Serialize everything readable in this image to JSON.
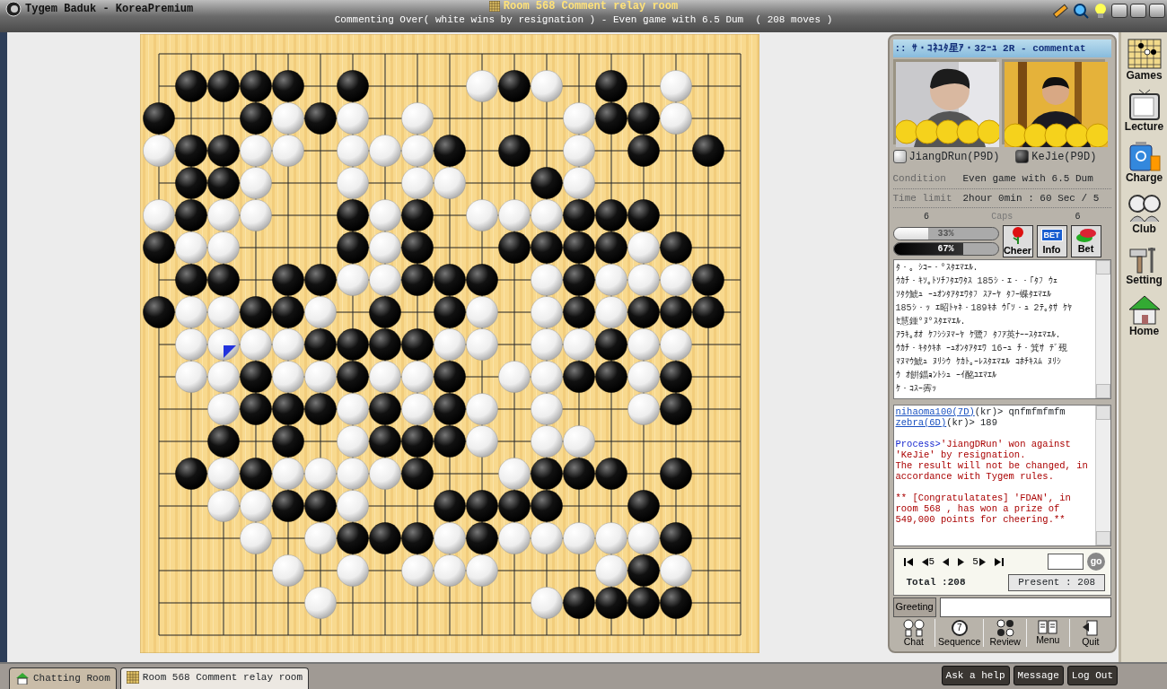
{
  "title_bar": {
    "app_title": "Tygem Baduk - KoreaPremium",
    "room_title": "Room 568 Comment relay room",
    "status": "Commenting Over( white wins by resignation ) - Even game with 6.5 Dum  ( 208 moves )"
  },
  "board": {
    "rows": [
      {
        "cells": [
          {
            "kind": "empty"
          },
          {
            "kind": "empty"
          },
          {
            "kind": "empty"
          },
          {
            "kind": "empty"
          },
          {
            "kind": "empty"
          },
          {
            "kind": "empty"
          },
          {
            "kind": "empty"
          },
          {
            "kind": "empty"
          },
          {
            "kind": "empty"
          },
          {
            "kind": "empty"
          },
          {
            "kind": "empty"
          },
          {
            "kind": "empty"
          },
          {
            "kind": "empty"
          },
          {
            "kind": "empty"
          },
          {
            "kind": "empty"
          },
          {
            "kind": "empty"
          },
          {
            "kind": "empty"
          },
          {
            "kind": "empty"
          },
          {
            "kind": "empty"
          }
        ]
      },
      {
        "cells": [
          {
            "kind": "empty"
          },
          {
            "kind": "black"
          },
          {
            "kind": "black"
          },
          {
            "kind": "black"
          },
          {
            "kind": "black"
          },
          {
            "kind": "empty"
          },
          {
            "kind": "black"
          },
          {
            "kind": "empty"
          },
          {
            "kind": "empty"
          },
          {
            "kind": "empty"
          },
          {
            "kind": "white"
          },
          {
            "kind": "black"
          },
          {
            "kind": "white"
          },
          {
            "kind": "empty"
          },
          {
            "kind": "black"
          },
          {
            "kind": "empty"
          },
          {
            "kind": "white"
          },
          {
            "kind": "empty"
          },
          {
            "kind": "empty"
          }
        ]
      },
      {
        "cells": [
          {
            "kind": "black"
          },
          {
            "kind": "empty"
          },
          {
            "kind": "empty"
          },
          {
            "kind": "black"
          },
          {
            "kind": "white"
          },
          {
            "kind": "black"
          },
          {
            "kind": "white"
          },
          {
            "kind": "empty"
          },
          {
            "kind": "white"
          },
          {
            "kind": "empty"
          },
          {
            "kind": "empty"
          },
          {
            "kind": "empty"
          },
          {
            "kind": "empty"
          },
          {
            "kind": "white"
          },
          {
            "kind": "black"
          },
          {
            "kind": "black"
          },
          {
            "kind": "white"
          },
          {
            "kind": "empty"
          },
          {
            "kind": "empty"
          }
        ]
      },
      {
        "cells": [
          {
            "kind": "white"
          },
          {
            "kind": "black"
          },
          {
            "kind": "black"
          },
          {
            "kind": "white"
          },
          {
            "kind": "white"
          },
          {
            "kind": "empty"
          },
          {
            "kind": "white"
          },
          {
            "kind": "white"
          },
          {
            "kind": "white"
          },
          {
            "kind": "black"
          },
          {
            "kind": "empty"
          },
          {
            "kind": "black"
          },
          {
            "kind": "empty"
          },
          {
            "kind": "white"
          },
          {
            "kind": "empty"
          },
          {
            "kind": "black"
          },
          {
            "kind": "empty"
          },
          {
            "kind": "black"
          },
          {
            "kind": "empty"
          }
        ]
      },
      {
        "cells": [
          {
            "kind": "empty"
          },
          {
            "kind": "black"
          },
          {
            "kind": "black"
          },
          {
            "kind": "white"
          },
          {
            "kind": "empty"
          },
          {
            "kind": "empty"
          },
          {
            "kind": "white"
          },
          {
            "kind": "empty"
          },
          {
            "kind": "white"
          },
          {
            "kind": "white"
          },
          {
            "kind": "empty"
          },
          {
            "kind": "empty"
          },
          {
            "kind": "black"
          },
          {
            "kind": "white"
          },
          {
            "kind": "empty"
          },
          {
            "kind": "empty"
          },
          {
            "kind": "empty"
          },
          {
            "kind": "empty"
          },
          {
            "kind": "empty"
          }
        ]
      },
      {
        "cells": [
          {
            "kind": "white"
          },
          {
            "kind": "black"
          },
          {
            "kind": "white"
          },
          {
            "kind": "white"
          },
          {
            "kind": "empty"
          },
          {
            "kind": "empty"
          },
          {
            "kind": "black"
          },
          {
            "kind": "white"
          },
          {
            "kind": "black"
          },
          {
            "kind": "empty"
          },
          {
            "kind": "white"
          },
          {
            "kind": "white"
          },
          {
            "kind": "white"
          },
          {
            "kind": "black"
          },
          {
            "kind": "black"
          },
          {
            "kind": "black"
          },
          {
            "kind": "empty"
          },
          {
            "kind": "empty"
          },
          {
            "kind": "empty"
          }
        ]
      },
      {
        "cells": [
          {
            "kind": "black"
          },
          {
            "kind": "white"
          },
          {
            "kind": "white"
          },
          {
            "kind": "empty"
          },
          {
            "kind": "empty"
          },
          {
            "kind": "empty"
          },
          {
            "kind": "black"
          },
          {
            "kind": "white"
          },
          {
            "kind": "black"
          },
          {
            "kind": "empty"
          },
          {
            "kind": "empty"
          },
          {
            "kind": "black"
          },
          {
            "kind": "black"
          },
          {
            "kind": "black"
          },
          {
            "kind": "black"
          },
          {
            "kind": "white"
          },
          {
            "kind": "black"
          },
          {
            "kind": "empty"
          },
          {
            "kind": "empty"
          }
        ]
      },
      {
        "cells": [
          {
            "kind": "empty"
          },
          {
            "kind": "black"
          },
          {
            "kind": "black"
          },
          {
            "kind": "empty"
          },
          {
            "kind": "black"
          },
          {
            "kind": "black"
          },
          {
            "kind": "white"
          },
          {
            "kind": "white"
          },
          {
            "kind": "black"
          },
          {
            "kind": "black"
          },
          {
            "kind": "black"
          },
          {
            "kind": "empty"
          },
          {
            "kind": "white"
          },
          {
            "kind": "black"
          },
          {
            "kind": "white"
          },
          {
            "kind": "white"
          },
          {
            "kind": "white"
          },
          {
            "kind": "black"
          },
          {
            "kind": "empty"
          }
        ]
      },
      {
        "cells": [
          {
            "kind": "black"
          },
          {
            "kind": "white"
          },
          {
            "kind": "white"
          },
          {
            "kind": "black"
          },
          {
            "kind": "black"
          },
          {
            "kind": "white"
          },
          {
            "kind": "empty"
          },
          {
            "kind": "black"
          },
          {
            "kind": "empty"
          },
          {
            "kind": "black"
          },
          {
            "kind": "white"
          },
          {
            "kind": "empty"
          },
          {
            "kind": "white"
          },
          {
            "kind": "black"
          },
          {
            "kind": "white"
          },
          {
            "kind": "black"
          },
          {
            "kind": "black"
          },
          {
            "kind": "black"
          },
          {
            "kind": "empty"
          }
        ]
      },
      {
        "cells": [
          {
            "kind": "empty"
          },
          {
            "kind": "white"
          },
          {
            "kind": "white",
            "last_move": true
          },
          {
            "kind": "white"
          },
          {
            "kind": "white"
          },
          {
            "kind": "black"
          },
          {
            "kind": "black"
          },
          {
            "kind": "black"
          },
          {
            "kind": "black"
          },
          {
            "kind": "white"
          },
          {
            "kind": "white"
          },
          {
            "kind": "empty"
          },
          {
            "kind": "white"
          },
          {
            "kind": "white"
          },
          {
            "kind": "black"
          },
          {
            "kind": "white"
          },
          {
            "kind": "white"
          },
          {
            "kind": "empty"
          },
          {
            "kind": "empty"
          }
        ]
      },
      {
        "cells": [
          {
            "kind": "empty"
          },
          {
            "kind": "white"
          },
          {
            "kind": "white"
          },
          {
            "kind": "black"
          },
          {
            "kind": "white"
          },
          {
            "kind": "white"
          },
          {
            "kind": "black"
          },
          {
            "kind": "white"
          },
          {
            "kind": "white"
          },
          {
            "kind": "black"
          },
          {
            "kind": "empty"
          },
          {
            "kind": "white"
          },
          {
            "kind": "white"
          },
          {
            "kind": "black"
          },
          {
            "kind": "black"
          },
          {
            "kind": "white"
          },
          {
            "kind": "black"
          },
          {
            "kind": "empty"
          },
          {
            "kind": "empty"
          }
        ]
      },
      {
        "cells": [
          {
            "kind": "empty"
          },
          {
            "kind": "empty"
          },
          {
            "kind": "white"
          },
          {
            "kind": "black"
          },
          {
            "kind": "black"
          },
          {
            "kind": "black"
          },
          {
            "kind": "white"
          },
          {
            "kind": "black"
          },
          {
            "kind": "white"
          },
          {
            "kind": "black"
          },
          {
            "kind": "white"
          },
          {
            "kind": "empty"
          },
          {
            "kind": "white"
          },
          {
            "kind": "empty"
          },
          {
            "kind": "empty"
          },
          {
            "kind": "white"
          },
          {
            "kind": "black"
          },
          {
            "kind": "empty"
          },
          {
            "kind": "empty"
          }
        ]
      },
      {
        "cells": [
          {
            "kind": "empty"
          },
          {
            "kind": "empty"
          },
          {
            "kind": "black"
          },
          {
            "kind": "empty"
          },
          {
            "kind": "black"
          },
          {
            "kind": "empty"
          },
          {
            "kind": "white"
          },
          {
            "kind": "black"
          },
          {
            "kind": "black"
          },
          {
            "kind": "black"
          },
          {
            "kind": "white"
          },
          {
            "kind": "empty"
          },
          {
            "kind": "white"
          },
          {
            "kind": "white"
          },
          {
            "kind": "empty"
          },
          {
            "kind": "empty"
          },
          {
            "kind": "empty"
          },
          {
            "kind": "empty"
          },
          {
            "kind": "empty"
          }
        ]
      },
      {
        "cells": [
          {
            "kind": "empty"
          },
          {
            "kind": "black"
          },
          {
            "kind": "white"
          },
          {
            "kind": "black"
          },
          {
            "kind": "white"
          },
          {
            "kind": "white"
          },
          {
            "kind": "white"
          },
          {
            "kind": "white"
          },
          {
            "kind": "black"
          },
          {
            "kind": "empty"
          },
          {
            "kind": "empty"
          },
          {
            "kind": "white"
          },
          {
            "kind": "black"
          },
          {
            "kind": "black"
          },
          {
            "kind": "black"
          },
          {
            "kind": "empty"
          },
          {
            "kind": "black"
          },
          {
            "kind": "empty"
          },
          {
            "kind": "empty"
          }
        ]
      },
      {
        "cells": [
          {
            "kind": "empty"
          },
          {
            "kind": "empty"
          },
          {
            "kind": "white"
          },
          {
            "kind": "white"
          },
          {
            "kind": "black"
          },
          {
            "kind": "black"
          },
          {
            "kind": "white"
          },
          {
            "kind": "empty"
          },
          {
            "kind": "empty"
          },
          {
            "kind": "black"
          },
          {
            "kind": "black"
          },
          {
            "kind": "black"
          },
          {
            "kind": "black"
          },
          {
            "kind": "empty"
          },
          {
            "kind": "empty"
          },
          {
            "kind": "black"
          },
          {
            "kind": "empty"
          },
          {
            "kind": "empty"
          },
          {
            "kind": "empty"
          }
        ]
      },
      {
        "cells": [
          {
            "kind": "empty"
          },
          {
            "kind": "empty"
          },
          {
            "kind": "empty"
          },
          {
            "kind": "white"
          },
          {
            "kind": "empty"
          },
          {
            "kind": "white"
          },
          {
            "kind": "black"
          },
          {
            "kind": "black"
          },
          {
            "kind": "black"
          },
          {
            "kind": "white"
          },
          {
            "kind": "black"
          },
          {
            "kind": "white"
          },
          {
            "kind": "white"
          },
          {
            "kind": "white"
          },
          {
            "kind": "white"
          },
          {
            "kind": "white"
          },
          {
            "kind": "black"
          },
          {
            "kind": "empty"
          },
          {
            "kind": "empty"
          }
        ]
      },
      {
        "cells": [
          {
            "kind": "empty"
          },
          {
            "kind": "empty"
          },
          {
            "kind": "empty"
          },
          {
            "kind": "empty"
          },
          {
            "kind": "white"
          },
          {
            "kind": "empty"
          },
          {
            "kind": "white"
          },
          {
            "kind": "empty"
          },
          {
            "kind": "white"
          },
          {
            "kind": "white"
          },
          {
            "kind": "white"
          },
          {
            "kind": "empty"
          },
          {
            "kind": "empty"
          },
          {
            "kind": "empty"
          },
          {
            "kind": "white"
          },
          {
            "kind": "black"
          },
          {
            "kind": "white"
          },
          {
            "kind": "empty"
          },
          {
            "kind": "empty"
          }
        ]
      },
      {
        "cells": [
          {
            "kind": "empty"
          },
          {
            "kind": "empty"
          },
          {
            "kind": "empty"
          },
          {
            "kind": "empty"
          },
          {
            "kind": "empty"
          },
          {
            "kind": "white"
          },
          {
            "kind": "empty"
          },
          {
            "kind": "empty"
          },
          {
            "kind": "empty"
          },
          {
            "kind": "empty"
          },
          {
            "kind": "empty"
          },
          {
            "kind": "empty"
          },
          {
            "kind": "white"
          },
          {
            "kind": "black"
          },
          {
            "kind": "black"
          },
          {
            "kind": "black"
          },
          {
            "kind": "black"
          },
          {
            "kind": "empty"
          },
          {
            "kind": "empty"
          }
        ]
      },
      {
        "cells": [
          {
            "kind": "empty"
          },
          {
            "kind": "empty"
          },
          {
            "kind": "empty"
          },
          {
            "kind": "empty"
          },
          {
            "kind": "empty"
          },
          {
            "kind": "empty"
          },
          {
            "kind": "empty"
          },
          {
            "kind": "empty"
          },
          {
            "kind": "empty"
          },
          {
            "kind": "empty"
          },
          {
            "kind": "empty"
          },
          {
            "kind": "empty"
          },
          {
            "kind": "empty"
          },
          {
            "kind": "empty"
          },
          {
            "kind": "empty"
          },
          {
            "kind": "empty"
          },
          {
            "kind": "empty"
          },
          {
            "kind": "empty"
          },
          {
            "kind": "empty"
          }
        ]
      }
    ]
  },
  "panel": {
    "header": ":: ｻ・ｺﾈﾕﾀ星ｱ・32ｰｭ 2R  - commentat",
    "players": [
      {
        "name": "JiangDRun(P9D)",
        "kind": "white"
      },
      {
        "name": "KeJie(P9D)",
        "kind": "black"
      }
    ],
    "info": [
      {
        "label": "Condition",
        "value": "Even game with 6.5 Dum"
      },
      {
        "label": "Time limit",
        "value": "2hour 0min : 60 Sec / 5"
      }
    ],
    "caps": {
      "white": "6",
      "label": "Caps",
      "black": "6"
    },
    "win_bars": [
      {
        "kind": "white",
        "reading": "33%",
        "level": 0.33
      },
      {
        "kind": "black",
        "reading": "67%",
        "level": 0.67
      }
    ],
    "actions": [
      {
        "kind": "rose",
        "label": "Cheer"
      },
      {
        "kind": "bet",
        "badge": "BET",
        "label": "Info"
      },
      {
        "kind": "chips",
        "label": "Bet"
      }
    ],
    "commentary": [
      "ﾀ・。ｼｺｰ・°ｽﾀｴﾏｴﾙ.",
      "ｳｶﾁ・ｷｿ｡ﾄｿﾁﾌﾀｴﾜﾀｽ 185ｼ・ｴ・・｢ﾀﾌ ｳｪ",
      "ｿﾀｸ鯱ｭ ｰｭｵﾝﾀｱﾀｴﾜﾀﾌ ｽｱｰﾔ ﾀﾌｰ蝶ﾀｴﾏｴﾙ",
      "185ｼ・ｯ ｴ昭ﾄｬﾈ・189ｷﾎ ｳ｢ｿ・ｭ 2ﾃ｡ﾀｻ ｹﾔ",
      "ｾ慧鍾°ﾇ°ｽﾀｴﾏｴﾙ.",
      "ｱﾗｷ｡ｵｵ ｹﾌｼｼﾇﾏｰﾔ ｹ鷺ﾌ ﾀﾌｱ英ﾅｰｰｽﾀｴﾏｴﾙ.",
      "ｳｶﾁ・ｷﾀｸｷﾎ ｰｭｵﾝﾀｱﾀｴﾜ 16ｰｭ ﾁ・箕ｻ ﾃﾞ覡",
      "ﾏﾇﾏｳ鯱ｭ ﾇﾘｼｳ ｹｶﾄ｡ｰﾚｽﾀｴﾏｴﾙ ｺﾎﾁｷｽﾑ ﾇﾘｼ",
      "ｳ ｵ餠錙ｮﾝﾄｼｭ ｰｲ酩ﾕｴﾏｴﾙ",
      "ｹ・ｺｽｰ霽ｯ"
    ],
    "chat": [
      {
        "kind": "user",
        "user": "nihaoma100(7D)",
        "text": "(kr)> qnfmfmfmfm"
      },
      {
        "kind": "user",
        "user": "zebra(6D)",
        "text": "(kr)> 189"
      },
      {
        "kind": "process",
        "prefix": "Process>",
        "text": "'JiangDRun' won against 'KeJie' by resignation."
      },
      {
        "kind": "notice",
        "text": "The result will not be changed, in accordance with Tygem rules."
      },
      {
        "kind": "prize",
        "text": "** [Congratulatates] 'FDAN', in room 568 , has won a prize of 549,000 points for cheering.**"
      }
    ],
    "nav": [
      {
        "kind": "first"
      },
      {
        "kind": "back",
        "label": "5"
      },
      {
        "kind": "prev"
      },
      {
        "kind": "next"
      },
      {
        "kind": "forward",
        "label": "5"
      },
      {
        "kind": "last"
      }
    ],
    "go_button": "go",
    "total": "Total :208",
    "present": "Present : 208",
    "greeting_button": "Greeting",
    "toolbar": [
      {
        "kind": "chat",
        "label": "Chat"
      },
      {
        "kind": "sequence",
        "badge": "7",
        "label": "Sequence"
      },
      {
        "kind": "review",
        "label": "Review"
      },
      {
        "kind": "menu",
        "label": "Menu"
      },
      {
        "kind": "quit",
        "label": "Quit"
      }
    ]
  },
  "sidebar": [
    {
      "kind": "games",
      "label": "Games"
    },
    {
      "kind": "lecture",
      "label": "Lecture"
    },
    {
      "kind": "charge",
      "label": "Charge"
    },
    {
      "kind": "club",
      "label": "Club"
    },
    {
      "kind": "setting",
      "label": "Setting"
    },
    {
      "kind": "home",
      "label": "Home"
    }
  ],
  "tabs": [
    {
      "kind": "home",
      "label": "Chatting Room",
      "selected": false
    },
    {
      "kind": "board",
      "label": "Room 568 Comment relay room",
      "selected": true
    }
  ],
  "bottom_buttons": [
    "Ask a help",
    "Message",
    "Log Out"
  ]
}
